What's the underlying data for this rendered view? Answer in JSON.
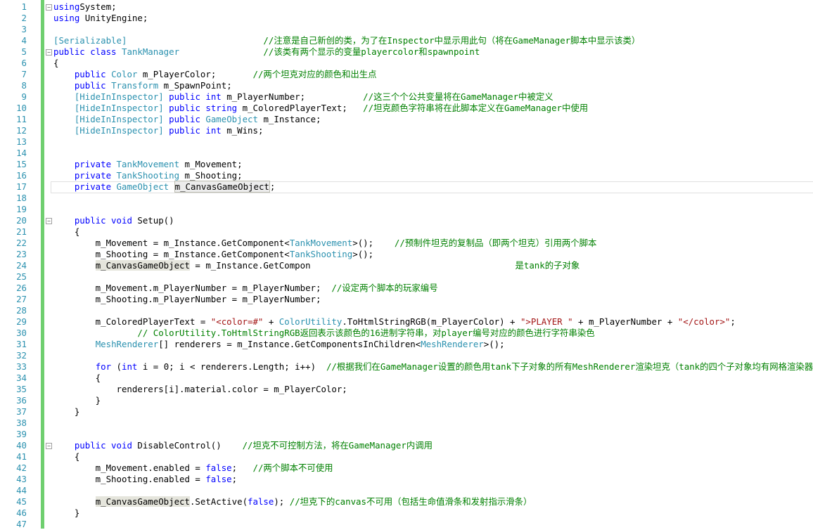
{
  "editor": {
    "lines": [
      {
        "n": "1",
        "fold": "minus",
        "tokens": [
          [
            "kw",
            "using"
          ],
          [
            "",
            "System;"
          ]
        ]
      },
      {
        "n": "2",
        "fold": "",
        "tokens": [
          [
            "kw",
            "using"
          ],
          [
            "",
            " UnityEngine;"
          ]
        ]
      },
      {
        "n": "3",
        "fold": "",
        "tokens": []
      },
      {
        "n": "4",
        "fold": "",
        "tokens": [
          [
            "ty",
            "[Serializable]"
          ],
          [
            "",
            "                          "
          ],
          [
            "cm",
            "//注意是自己新创的类，为了在Inspector中显示用此句（将在GameManager脚本中显示该类）"
          ]
        ]
      },
      {
        "n": "5",
        "fold": "minus",
        "tokens": [
          [
            "kw",
            "public class"
          ],
          [
            "",
            " "
          ],
          [
            "ty",
            "TankManager"
          ],
          [
            "",
            "                "
          ],
          [
            "cm",
            "//该类有两个显示的变量playercolor和spawnpoint"
          ]
        ]
      },
      {
        "n": "6",
        "fold": "",
        "tokens": [
          [
            "",
            "{"
          ]
        ]
      },
      {
        "n": "7",
        "fold": "",
        "tokens": [
          [
            "",
            "    "
          ],
          [
            "kw",
            "public"
          ],
          [
            "",
            " "
          ],
          [
            "ty",
            "Color"
          ],
          [
            "",
            " m_PlayerColor;       "
          ],
          [
            "cm",
            "//两个坦克对应的颜色和出生点"
          ]
        ]
      },
      {
        "n": "8",
        "fold": "",
        "tokens": [
          [
            "",
            "    "
          ],
          [
            "kw",
            "public"
          ],
          [
            "",
            " "
          ],
          [
            "ty",
            "Transform"
          ],
          [
            "",
            " m_SpawnPoint;"
          ]
        ]
      },
      {
        "n": "9",
        "fold": "",
        "tokens": [
          [
            "",
            "    "
          ],
          [
            "ty",
            "[HideInInspector]"
          ],
          [
            "",
            " "
          ],
          [
            "kw",
            "public int"
          ],
          [
            "",
            " m_PlayerNumber;           "
          ],
          [
            "cm",
            "//这三个个公共变量将在GameManager中被定义"
          ]
        ]
      },
      {
        "n": "10",
        "fold": "",
        "tokens": [
          [
            "",
            "    "
          ],
          [
            "ty",
            "[HideInInspector]"
          ],
          [
            "",
            " "
          ],
          [
            "kw",
            "public string"
          ],
          [
            "",
            " m_ColoredPlayerText;   "
          ],
          [
            "cm",
            "//坦克颜色字符串将在此脚本定义在GameManager中使用"
          ]
        ]
      },
      {
        "n": "11",
        "fold": "",
        "tokens": [
          [
            "",
            "    "
          ],
          [
            "ty",
            "[HideInInspector]"
          ],
          [
            "",
            " "
          ],
          [
            "kw",
            "public"
          ],
          [
            "",
            " "
          ],
          [
            "ty",
            "GameObject"
          ],
          [
            "",
            " m_Instance;"
          ]
        ]
      },
      {
        "n": "12",
        "fold": "",
        "tokens": [
          [
            "",
            "    "
          ],
          [
            "ty",
            "[HideInInspector]"
          ],
          [
            "",
            " "
          ],
          [
            "kw",
            "public int"
          ],
          [
            "",
            " m_Wins;"
          ]
        ]
      },
      {
        "n": "13",
        "fold": "",
        "tokens": []
      },
      {
        "n": "14",
        "fold": "",
        "tokens": []
      },
      {
        "n": "15",
        "fold": "",
        "tokens": [
          [
            "",
            "    "
          ],
          [
            "kw",
            "private"
          ],
          [
            "",
            " "
          ],
          [
            "ty",
            "TankMovement"
          ],
          [
            "",
            " m_Movement;"
          ]
        ]
      },
      {
        "n": "16",
        "fold": "",
        "tokens": [
          [
            "",
            "    "
          ],
          [
            "kw",
            "private"
          ],
          [
            "",
            " "
          ],
          [
            "ty",
            "TankShooting"
          ],
          [
            "",
            " m_Shooting;"
          ]
        ]
      },
      {
        "n": "17",
        "fold": "",
        "tokens": [
          [
            "",
            "    "
          ],
          [
            "kw",
            "private"
          ],
          [
            "",
            " "
          ],
          [
            "ty",
            "GameObject"
          ],
          [
            "",
            " "
          ],
          [
            "hlbox",
            "m_CanvasGameObject"
          ],
          [
            "",
            ";"
          ]
        ]
      },
      {
        "n": "18",
        "fold": "",
        "tokens": []
      },
      {
        "n": "19",
        "fold": "",
        "tokens": []
      },
      {
        "n": "20",
        "fold": "minus",
        "tokens": [
          [
            "",
            "    "
          ],
          [
            "kw",
            "public void"
          ],
          [
            "",
            " Setup()"
          ]
        ]
      },
      {
        "n": "21",
        "fold": "",
        "tokens": [
          [
            "",
            "    {"
          ]
        ]
      },
      {
        "n": "22",
        "fold": "",
        "tokens": [
          [
            "",
            "        m_Movement = m_Instance.GetComponent<"
          ],
          [
            "ty",
            "TankMovement"
          ],
          [
            "",
            ">();    "
          ],
          [
            "cm",
            "//预制件坦克的复制品（即两个坦克）引用两个脚本"
          ]
        ]
      },
      {
        "n": "23",
        "fold": "",
        "tokens": [
          [
            "",
            "        m_Shooting = m_Instance.GetComponent<"
          ],
          [
            "ty",
            "TankShooting"
          ],
          [
            "",
            ">();"
          ]
        ]
      },
      {
        "n": "24",
        "fold": "",
        "tokens": [
          [
            "",
            "        "
          ],
          [
            "hl",
            "m_CanvasGameObject"
          ],
          [
            "",
            " = m_Instance.GetCompon"
          ],
          [
            "cm",
            "                                       是tank的子对象"
          ]
        ]
      },
      {
        "n": "25",
        "fold": "",
        "tokens": []
      },
      {
        "n": "26",
        "fold": "",
        "tokens": [
          [
            "",
            "        m_Movement.m_PlayerNumber = m_PlayerNumber;  "
          ],
          [
            "cm",
            "//设定两个脚本的玩家编号"
          ]
        ]
      },
      {
        "n": "27",
        "fold": "",
        "tokens": [
          [
            "",
            "        m_Shooting.m_PlayerNumber = m_PlayerNumber;"
          ]
        ]
      },
      {
        "n": "28",
        "fold": "",
        "tokens": []
      },
      {
        "n": "29",
        "fold": "",
        "tokens": [
          [
            "",
            "        m_ColoredPlayerText = "
          ],
          [
            "st",
            "\"<color=#\""
          ],
          [
            "",
            " + "
          ],
          [
            "ty",
            "ColorUtility"
          ],
          [
            "",
            ".ToHtmlStringRGB(m_PlayerColor) + "
          ],
          [
            "st",
            "\">PLAYER \""
          ],
          [
            "",
            " + m_PlayerNumber + "
          ],
          [
            "st",
            "\"</color>\""
          ],
          [
            "",
            ";"
          ]
        ]
      },
      {
        "n": "30",
        "fold": "",
        "tokens": [
          [
            "",
            "                "
          ],
          [
            "cm",
            "// ColorUtility.ToHtmlStringRGB返回表示该颜色的16进制字符串，对player编号对应的颜色进行字符串染色"
          ]
        ]
      },
      {
        "n": "31",
        "fold": "",
        "tokens": [
          [
            "",
            "        "
          ],
          [
            "ty",
            "MeshRenderer"
          ],
          [
            "",
            "[] renderers = m_Instance.GetComponentsInChildren<"
          ],
          [
            "ty",
            "MeshRenderer"
          ],
          [
            "",
            ">();"
          ]
        ]
      },
      {
        "n": "32",
        "fold": "",
        "tokens": []
      },
      {
        "n": "33",
        "fold": "",
        "tokens": [
          [
            "",
            "        "
          ],
          [
            "kw",
            "for"
          ],
          [
            "",
            " ("
          ],
          [
            "kw",
            "int"
          ],
          [
            "",
            " i = 0; i < renderers.Length; i++)  "
          ],
          [
            "cm",
            "//根据我们在GameManager设置的颜色用tank下子对象的所有MeshRenderer渲染坦克（tank的四个子对象均有网格渲染器）"
          ]
        ]
      },
      {
        "n": "34",
        "fold": "",
        "tokens": [
          [
            "",
            "        {"
          ]
        ]
      },
      {
        "n": "35",
        "fold": "",
        "tokens": [
          [
            "",
            "            renderers[i].material.color = m_PlayerColor;"
          ]
        ]
      },
      {
        "n": "36",
        "fold": "",
        "tokens": [
          [
            "",
            "        }"
          ]
        ]
      },
      {
        "n": "37",
        "fold": "",
        "tokens": [
          [
            "",
            "    }"
          ]
        ]
      },
      {
        "n": "38",
        "fold": "",
        "tokens": []
      },
      {
        "n": "39",
        "fold": "",
        "tokens": []
      },
      {
        "n": "40",
        "fold": "minus",
        "tokens": [
          [
            "",
            "    "
          ],
          [
            "kw",
            "public void"
          ],
          [
            "",
            " DisableControl()    "
          ],
          [
            "cm",
            "//坦克不可控制方法，将在GameManager内调用"
          ]
        ]
      },
      {
        "n": "41",
        "fold": "",
        "tokens": [
          [
            "",
            "    {"
          ]
        ]
      },
      {
        "n": "42",
        "fold": "",
        "tokens": [
          [
            "",
            "        m_Movement.enabled = "
          ],
          [
            "kw",
            "false"
          ],
          [
            "",
            ";   "
          ],
          [
            "cm",
            "//两个脚本不可使用"
          ]
        ]
      },
      {
        "n": "43",
        "fold": "",
        "tokens": [
          [
            "",
            "        m_Shooting.enabled = "
          ],
          [
            "kw",
            "false"
          ],
          [
            "",
            ";"
          ]
        ]
      },
      {
        "n": "44",
        "fold": "",
        "tokens": []
      },
      {
        "n": "45",
        "fold": "",
        "tokens": [
          [
            "",
            "        "
          ],
          [
            "hl",
            "m_CanvasGameObject"
          ],
          [
            "",
            ".SetActive("
          ],
          [
            "kw",
            "false"
          ],
          [
            "",
            "); "
          ],
          [
            "cm",
            "//坦克下的canvas不可用（包括生命值滑条和发射指示滑条）"
          ]
        ]
      },
      {
        "n": "46",
        "fold": "",
        "tokens": [
          [
            "",
            "    }"
          ]
        ]
      },
      {
        "n": "47",
        "fold": "",
        "tokens": []
      }
    ]
  }
}
